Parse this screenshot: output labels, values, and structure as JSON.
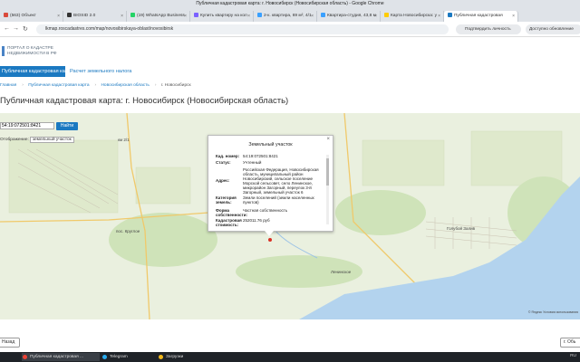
{
  "window": {
    "title": "Публичная кадастровая карта: г. Новосибирск (Новосибирская область) - Google Chrome"
  },
  "tabs": [
    {
      "label": "(563) Объект",
      "color": "#d94a3b"
    },
    {
      "label": "BIOSID 2.0",
      "color": "#333333"
    },
    {
      "label": "(19) WhatsApp Business",
      "color": "#25d366"
    },
    {
      "label": "Купить квартиру на кол",
      "color": "#7b61ff"
    },
    {
      "label": "2-к. квартира, 69 м², 4/1",
      "color": "#3aa0ff"
    },
    {
      "label": "Квартира-студия, 43,8 м",
      "color": "#3aa0ff"
    },
    {
      "label": "Карта Новосибирска: у",
      "color": "#ffcc00"
    },
    {
      "label": "Публичная кадастровая",
      "color": "#1b79c1",
      "active": true
    }
  ],
  "address_bar": {
    "url": "lk.rosreestr.ru / pkk.rosreestr.ru › maps/novosibirskaya-oblast/novosibirsk",
    "url_display": "lkmap.roscadastres.com/map/novosibirskaya-oblast/novosibirsk",
    "translate_label": "Подтвердить личность",
    "update_label": "Доступно обновление"
  },
  "logo": {
    "line1": "ПОРТАЛ О КАДАСТРЕ",
    "line2": "НЕДВИЖИМОСТИ В РФ"
  },
  "menu": {
    "item1": "Публичная кадастровая карта",
    "item2": "Расчет земельного налога"
  },
  "breadcrumb": {
    "items": [
      "Главная",
      "Публичная кадастровая карта",
      "Новосибирская область",
      "г. Новосибирск"
    ]
  },
  "page_title": "Публичная кадастровая карта: г. Новосибирск (Новосибирская область)",
  "search": {
    "value": "54:19:072501:8421",
    "button": "Найти"
  },
  "layer": {
    "label": "Отображение:",
    "value": "земельный участок"
  },
  "popup": {
    "title": "Земельный участок",
    "rows": [
      {
        "k": "Кад. номер:",
        "v": "54:19:072501:8421"
      },
      {
        "k": "Статус:",
        "v": "Учтенный"
      },
      {
        "k": "Адрес:",
        "v": "Российская Федерация, Новосибирская область, муниципальный район Новосибирский, сельское поселение Морской сельсовет, село Ленинское, микрорайон Загорный, переулок 3-й Загорный, земельный участок 6"
      },
      {
        "k": "Категория земель:",
        "v": "Земли поселений (земли населенных пунктов)"
      },
      {
        "k": "Форма собственности:",
        "v": "Частная собственность"
      },
      {
        "k": "Кадастровая стоимость:",
        "v": "252011.76 руб"
      }
    ]
  },
  "map_labels": {
    "krugloe": "пос. Круглое",
    "golub": "Голубой Залив",
    "leninskoe": "Ленинское",
    "km": "км 2/1"
  },
  "map_credit": "© Яндекс Условия использования",
  "bottom": {
    "left": "Назад",
    "right": "г. Обь"
  },
  "taskbar": {
    "items": [
      {
        "label": "Публичная кадастровая ...",
        "color": "#ea4335",
        "active": true
      },
      {
        "label": "Telegram",
        "color": "#2aabee"
      },
      {
        "label": "Загрузки",
        "color": "#f2b81b"
      }
    ],
    "tray": "RU"
  }
}
